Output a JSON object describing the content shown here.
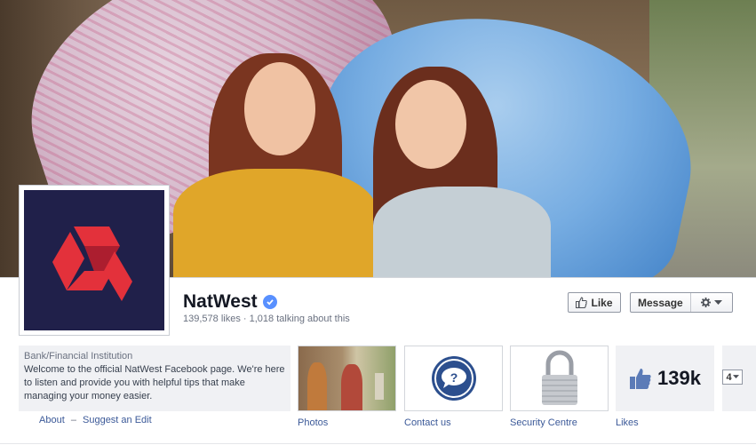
{
  "page": {
    "name": "NatWest",
    "likes_text": "139,578 likes",
    "talking_text": "1,018 talking about this",
    "separator": "·"
  },
  "buttons": {
    "like_label": "Like",
    "message_label": "Message"
  },
  "about": {
    "category": "Bank/Financial Institution",
    "description": "Welcome to the official NatWest Facebook page. We're here to listen and provide you with helpful tips that make managing your money easier.",
    "about_link": "About",
    "dash": "–",
    "suggest_link": "Suggest an Edit"
  },
  "apps": [
    {
      "label": "Photos"
    },
    {
      "label": "Contact us"
    },
    {
      "label": "Security Centre"
    },
    {
      "label": "Likes",
      "count": "139k"
    }
  ],
  "more_apps": {
    "count": "4"
  },
  "colors": {
    "brand_red": "#e3313b",
    "logo_bg": "#20204a",
    "link": "#3b5998",
    "verified": "#5890ff"
  },
  "icons": [
    "natwest-logo-icon",
    "verified-badge-icon",
    "thumbs-up-icon",
    "gear-icon",
    "chevron-down-icon",
    "speech-bubble-question-icon",
    "padlock-icon"
  ]
}
